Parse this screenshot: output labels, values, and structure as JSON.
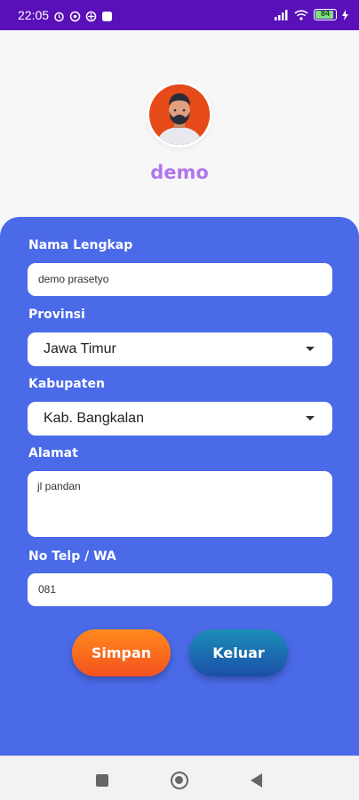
{
  "status_bar": {
    "time": "22:05",
    "battery": "84",
    "icons": [
      "alarm-icon",
      "whatsapp-icon",
      "location-icon",
      "app-icon",
      "signal-icon",
      "wifi-icon",
      "battery-icon",
      "charging-icon"
    ]
  },
  "profile": {
    "username": "demo",
    "avatar_icon": "person-avatar-icon"
  },
  "form": {
    "name_label": "Nama Lengkap",
    "name_value": "demo prasetyo",
    "province_label": "Provinsi",
    "province_value": "Jawa Timur",
    "regency_label": "Kabupaten",
    "regency_value": "Kab. Bangkalan",
    "address_label": "Alamat",
    "address_value": "jl pandan",
    "phone_label": "No Telp / WA",
    "phone_value": "081"
  },
  "actions": {
    "save_label": "Simpan",
    "exit_label": "Keluar"
  },
  "colors": {
    "status_bar": "#5a10b8",
    "card": "#4a6ae8",
    "username": "#b276ec",
    "save_button": "#f4511e",
    "exit_button": "#1a4fa8"
  },
  "nav_bar": {
    "icons": [
      "recents-icon",
      "home-icon",
      "back-icon"
    ]
  }
}
